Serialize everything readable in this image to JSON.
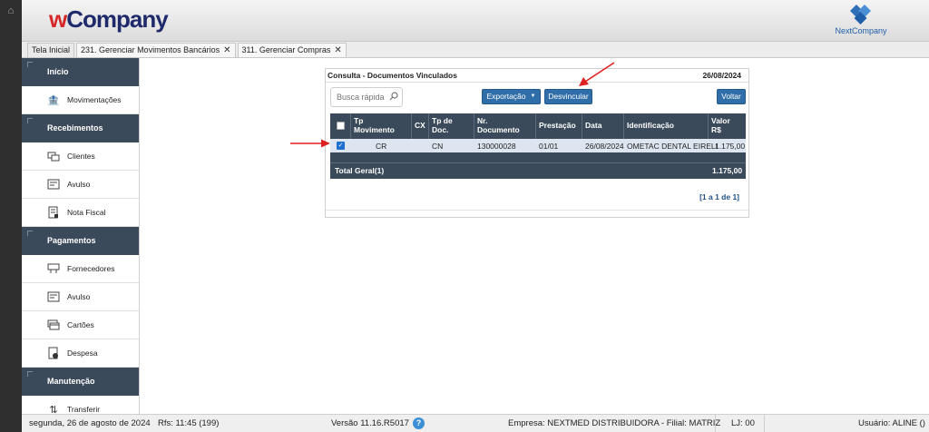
{
  "header": {
    "brand_w": "w",
    "brand_rest": "Company",
    "partner_logo_text": "NextCompany"
  },
  "tabs": [
    {
      "label": "Tela Inicial",
      "closable": false
    },
    {
      "label": "231. Gerenciar Movimentos Bancários",
      "closable": true,
      "close": "✕"
    },
    {
      "label": "311. Gerenciar Compras",
      "closable": true,
      "close": "✕"
    }
  ],
  "sidebar": {
    "sections": [
      {
        "title": "Início",
        "items": [
          {
            "label": "Movimentações",
            "icon": "bank-icon"
          }
        ]
      },
      {
        "title": "Recebimentos",
        "items": [
          {
            "label": "Clientes",
            "icon": "clients-icon"
          },
          {
            "label": "Avulso",
            "icon": "cash-register-icon"
          },
          {
            "label": "Nota Fiscal",
            "icon": "invoice-icon"
          }
        ]
      },
      {
        "title": "Pagamentos",
        "items": [
          {
            "label": "Fornecedores",
            "icon": "suppliers-icon"
          },
          {
            "label": "Avulso",
            "icon": "cash-register-icon"
          },
          {
            "label": "Cartões",
            "icon": "cards-icon"
          },
          {
            "label": "Despesa",
            "icon": "expense-icon"
          }
        ]
      },
      {
        "title": "Manutenção",
        "items": [
          {
            "label": "Transferir",
            "icon": "transfer-icon"
          }
        ]
      }
    ]
  },
  "panel": {
    "title": "Consulta - Documentos Vinculados",
    "date": "26/08/2024",
    "search_placeholder": "Busca rápida",
    "export_label": "Exportação",
    "unlink_label": "Desvincular",
    "back_label": "Voltar",
    "columns": {
      "tp_mov_1": "Tp",
      "tp_mov_2": "Movimento",
      "cx": "CX",
      "tp_doc_1": "Tp de",
      "tp_doc_2": "Doc.",
      "nr_doc_1": "Nr.",
      "nr_doc_2": "Documento",
      "prestacao": "Prestação",
      "data": "Data",
      "identificacao": "Identificação",
      "valor_1": "Valor",
      "valor_2": "R$"
    },
    "rows": [
      {
        "selected": true,
        "tp_movimento": "CR",
        "cx": "",
        "tp_doc": "CN",
        "nr_documento": "130000028",
        "prestacao": "01/01",
        "data": "26/08/2024",
        "identificacao": "OMETAC DENTAL EIRELI",
        "valor": "1.175,00"
      }
    ],
    "total_label": "Total Geral(1)",
    "total_value": "1.175,00",
    "pager": "[1 a 1 de 1]"
  },
  "footer": {
    "date": "segunda, 26 de agosto de 2024",
    "rfs": "Rfs: 11:45 (199)",
    "version": "Versão 11.16.R5017",
    "help": "?",
    "empresa": "Empresa: NEXTMED DISTRIBUIDORA - Filial: MATRIZ",
    "lj": "LJ: 00",
    "usuario": "Usuário: ALINE ()"
  },
  "colors": {
    "sidebar_header": "#3b4a5a",
    "button": "#2f6ea8",
    "brand_red": "#d62728",
    "brand_navy": "#1f2a6b",
    "annotation_arrow": "#e02020"
  }
}
